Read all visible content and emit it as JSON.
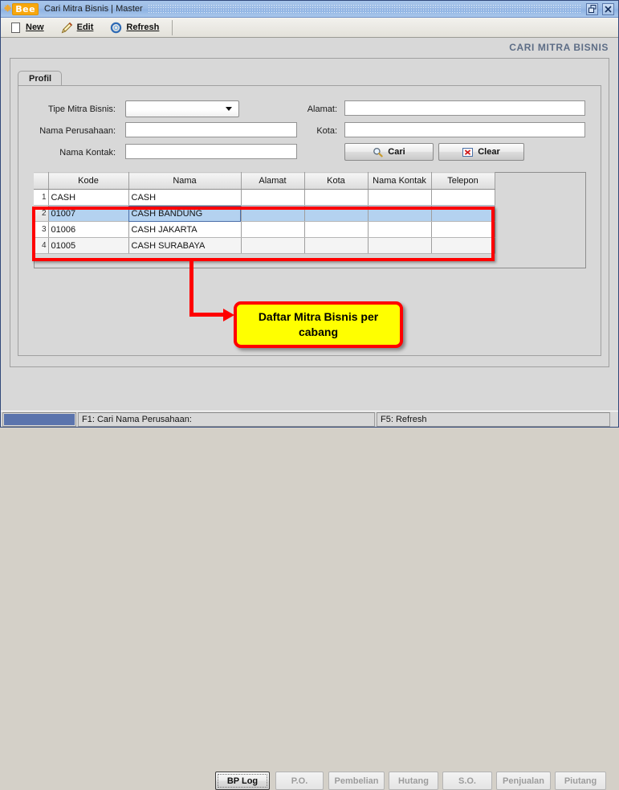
{
  "window": {
    "logo_text": "Bee",
    "title": "Cari Mitra Bisnis | Master",
    "restore_icon": "restore-icon",
    "close_icon": "close-icon"
  },
  "toolbar": {
    "items": [
      {
        "label": "New",
        "icon": "new-document-icon"
      },
      {
        "label": "Edit",
        "icon": "pencil-edit-icon"
      },
      {
        "label": "Refresh",
        "icon": "refresh-circular-icon"
      }
    ]
  },
  "page": {
    "header_title": "CARI MITRA BISNIS"
  },
  "tabs": [
    {
      "label": "Profil",
      "active": true
    }
  ],
  "form": {
    "left": [
      {
        "label": "Tipe Mitra Bisnis:",
        "type": "combo",
        "value": "",
        "placeholder": ""
      },
      {
        "label": "Nama Perusahaan:",
        "type": "text",
        "value": "",
        "placeholder": ""
      },
      {
        "label": "Nama Kontak:",
        "type": "text",
        "value": "",
        "placeholder": ""
      }
    ],
    "right": [
      {
        "label": "Alamat:",
        "type": "text",
        "value": "",
        "placeholder": ""
      },
      {
        "label": "Kota:",
        "type": "text",
        "value": "",
        "placeholder": ""
      }
    ],
    "buttons": [
      {
        "label": "Cari",
        "icon": "magnifier-search-icon"
      },
      {
        "label": "Clear",
        "icon": "red-x-clear-icon"
      }
    ]
  },
  "table": {
    "columns": [
      "Kode",
      "Nama",
      "Alamat",
      "Kota",
      "Nama Kontak",
      "Telepon"
    ],
    "rows": [
      {
        "num": "1",
        "cells": [
          "CASH",
          "CASH",
          "",
          "",
          "",
          ""
        ],
        "selected": false
      },
      {
        "num": "2",
        "cells": [
          "01007",
          "CASH BANDUNG",
          "",
          "",
          "",
          ""
        ],
        "selected": true
      },
      {
        "num": "3",
        "cells": [
          "01006",
          "CASH JAKARTA",
          "",
          "",
          "",
          ""
        ],
        "selected": false
      },
      {
        "num": "4",
        "cells": [
          "01005",
          "CASH SURABAYA",
          "",
          "",
          "",
          ""
        ],
        "selected": false
      }
    ]
  },
  "annotation": {
    "callout_text": "Daftar Mitra Bisnis per cabang",
    "highlight_color": "#ff0000",
    "callout_background": "#ffff00"
  },
  "bottom_buttons": [
    {
      "label": "BP Log",
      "disabled": false,
      "focused": true
    },
    {
      "label": "P.O.",
      "disabled": true,
      "focused": false
    },
    {
      "label": "Pembelian",
      "disabled": true,
      "focused": false
    },
    {
      "label": "Hutang",
      "disabled": true,
      "focused": false
    },
    {
      "label": "S.O.",
      "disabled": true,
      "focused": false
    },
    {
      "label": "Penjualan",
      "disabled": true,
      "focused": false
    },
    {
      "label": "Piutang",
      "disabled": true,
      "focused": false
    }
  ],
  "statusbar": {
    "progress_color": "#5b74ad",
    "hint_left": "F1: Cari Nama Perusahaan:",
    "hint_right": "F5: Refresh"
  }
}
